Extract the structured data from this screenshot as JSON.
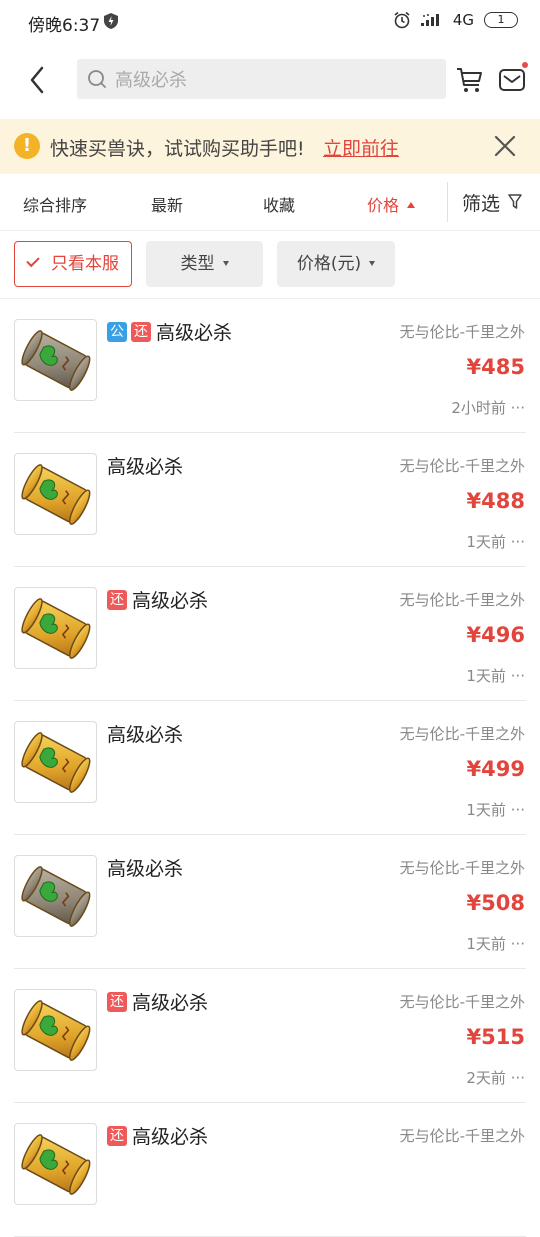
{
  "status": {
    "time": "傍晚6:37",
    "network": "4G",
    "signal": "ıll",
    "battery": "1"
  },
  "search": {
    "placeholder": "高级必杀"
  },
  "notice": {
    "text": "快速买兽诀，试试购买助手吧!",
    "link": "立即前往"
  },
  "sort": {
    "items": [
      "综合排序",
      "最新",
      "收藏",
      "价格"
    ],
    "active": "价格",
    "filter": "筛选"
  },
  "chips": {
    "own_server": "只看本服",
    "type": "类型",
    "price": "价格(元)"
  },
  "items": [
    {
      "tags": [
        "公",
        "还"
      ],
      "title": "高级必杀",
      "server": "无与伦比-千里之外",
      "price": "¥485",
      "time": "2小时前 ···",
      "thumb": "grey"
    },
    {
      "tags": [],
      "title": "高级必杀",
      "server": "无与伦比-千里之外",
      "price": "¥488",
      "time": "1天前 ···",
      "thumb": "gold"
    },
    {
      "tags": [
        "还"
      ],
      "title": "高级必杀",
      "server": "无与伦比-千里之外",
      "price": "¥496",
      "time": "1天前 ···",
      "thumb": "gold"
    },
    {
      "tags": [],
      "title": "高级必杀",
      "server": "无与伦比-千里之外",
      "price": "¥499",
      "time": "1天前 ···",
      "thumb": "gold"
    },
    {
      "tags": [],
      "title": "高级必杀",
      "server": "无与伦比-千里之外",
      "price": "¥508",
      "time": "1天前 ···",
      "thumb": "grey"
    },
    {
      "tags": [
        "还"
      ],
      "title": "高级必杀",
      "server": "无与伦比-千里之外",
      "price": "¥515",
      "time": "2天前 ···",
      "thumb": "gold"
    },
    {
      "tags": [
        "还"
      ],
      "title": "高级必杀",
      "server": "无与伦比-千里之外",
      "price": "",
      "time": "",
      "thumb": "gold"
    }
  ],
  "colors": {
    "accent": "#e2453c",
    "tag_gong": "#3aa0e6",
    "tag_huan": "#ee5a5a",
    "notice_bg": "#fdf4dd"
  }
}
